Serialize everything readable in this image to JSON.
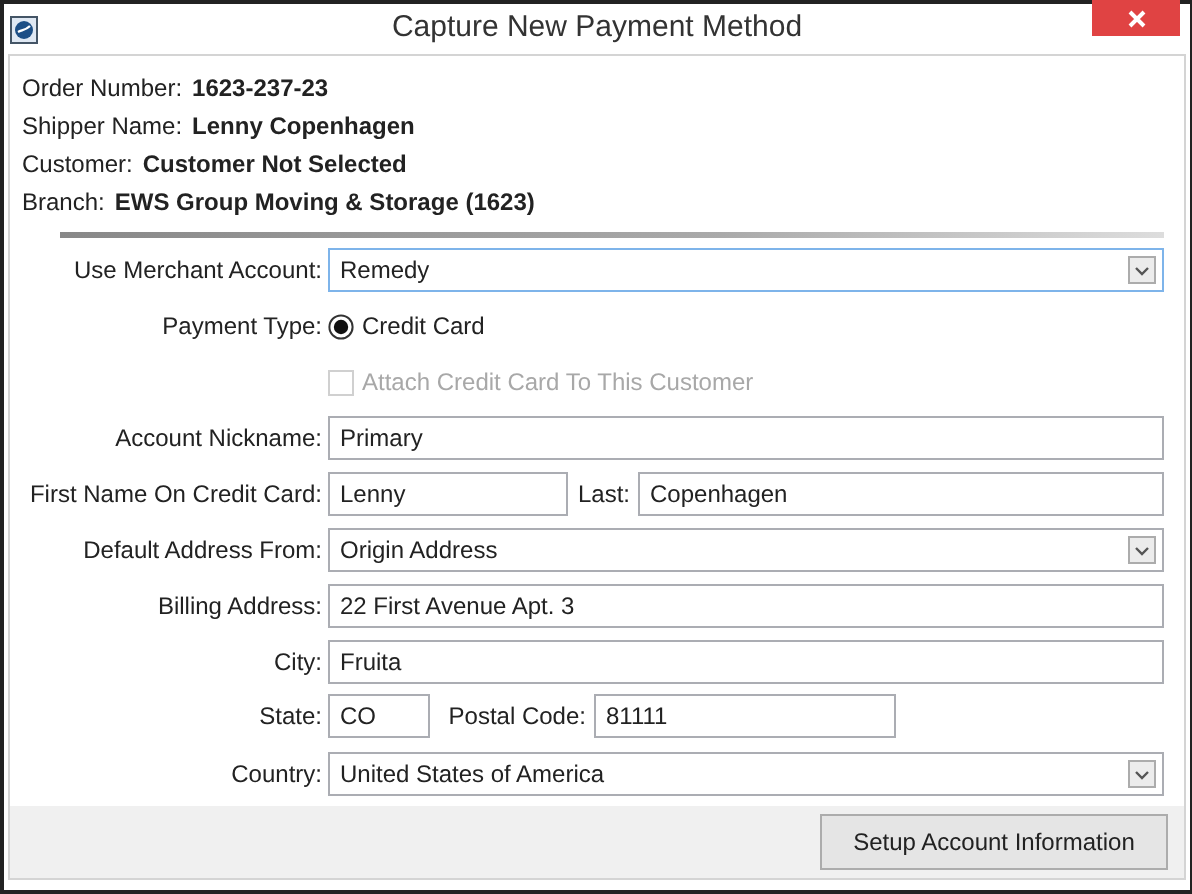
{
  "window": {
    "title": "Capture New Payment Method"
  },
  "info": [
    {
      "label": "Order Number:",
      "value": "1623-237-23"
    },
    {
      "label": "Shipper Name:",
      "value": "Lenny Copenhagen"
    },
    {
      "label": "Customer:",
      "value": "Customer Not Selected"
    },
    {
      "label": "Branch:",
      "value": "EWS Group Moving & Storage (1623)"
    }
  ],
  "form": [
    {
      "kind": "select",
      "label": "Use Merchant Account:",
      "value": "Remedy",
      "focused": true
    },
    {
      "kind": "radio",
      "label": "Payment Type:",
      "option": "Credit Card",
      "selected": true
    },
    {
      "kind": "checkbox",
      "option": "Attach Credit Card To This Customer",
      "checked": false,
      "disabled": true
    },
    {
      "kind": "text",
      "label": "Account Nickname:",
      "value": "Primary"
    },
    {
      "kind": "name-pair",
      "label": "First Name On Credit Card:",
      "value": "Lenny",
      "label_2": "Last:",
      "value_2": "Copenhagen"
    },
    {
      "kind": "select",
      "label": "Default Address From:",
      "value": "Origin Address",
      "focused": false
    },
    {
      "kind": "text",
      "label": "Billing Address:",
      "value": "22 First Avenue Apt. 3"
    },
    {
      "kind": "text",
      "label": "City:",
      "value": "Fruita"
    },
    {
      "kind": "state-pair",
      "label": "State:",
      "value": "CO",
      "label_2": "Postal Code:",
      "value_2": "81111"
    },
    {
      "kind": "select",
      "label": "Country:",
      "value": "United States of America",
      "focused": false
    }
  ],
  "buttons": [
    {
      "label": "Setup Account Information"
    }
  ]
}
